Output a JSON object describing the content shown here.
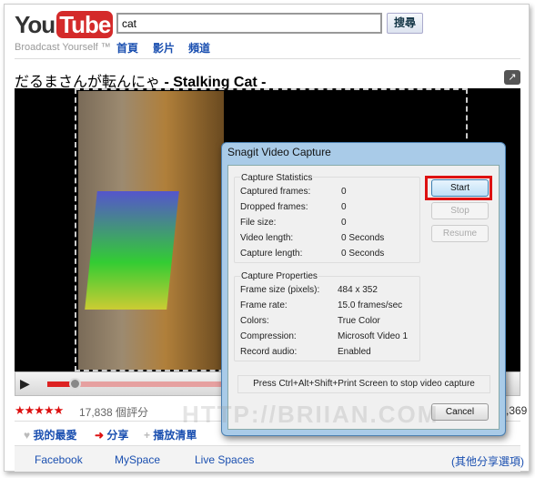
{
  "header": {
    "logo_you": "You",
    "logo_tube": "Tube",
    "tagline": "Broadcast Yourself ™",
    "search_value": "cat",
    "search_button": "搜尋",
    "nav": [
      "首頁",
      "影片",
      "頻道"
    ]
  },
  "video": {
    "title_jp": "だるまさんが転んにゃ",
    "title_en": "- Stalking Cat -",
    "popout_icon": "↗",
    "progress_percent": 7
  },
  "rating": {
    "stars": "★★★★★",
    "count": "17,838 個評分",
    "views": ",369"
  },
  "actions": {
    "favorite": "我的最愛",
    "share": "分享",
    "playlist": "播放清單"
  },
  "share_links": [
    "Facebook",
    "MySpace",
    "Live Spaces"
  ],
  "share_more": "(其他分享選項)",
  "dialog": {
    "title": "Snagit Video Capture",
    "stats_label": "Capture Statistics",
    "stats": [
      {
        "k": "Captured frames:",
        "v": "0"
      },
      {
        "k": "Dropped frames:",
        "v": "0"
      },
      {
        "k": "File size:",
        "v": "0"
      },
      {
        "k": "Video length:",
        "v": "0 Seconds"
      },
      {
        "k": "Capture length:",
        "v": "0 Seconds"
      }
    ],
    "props_label": "Capture Properties",
    "props": [
      {
        "k": "Frame size (pixels):",
        "v": "484 x 352"
      },
      {
        "k": "Frame rate:",
        "v": "15.0 frames/sec"
      },
      {
        "k": "Colors:",
        "v": "True Color"
      },
      {
        "k": "Compression:",
        "v": "Microsoft Video 1"
      },
      {
        "k": "Record audio:",
        "v": "Enabled"
      }
    ],
    "start": "Start",
    "stop": "Stop",
    "resume": "Resume",
    "cancel": "Cancel",
    "hint": "Press Ctrl+Alt+Shift+Print Screen to stop video capture"
  },
  "watermark": "HTTP://BRIIAN.COM"
}
